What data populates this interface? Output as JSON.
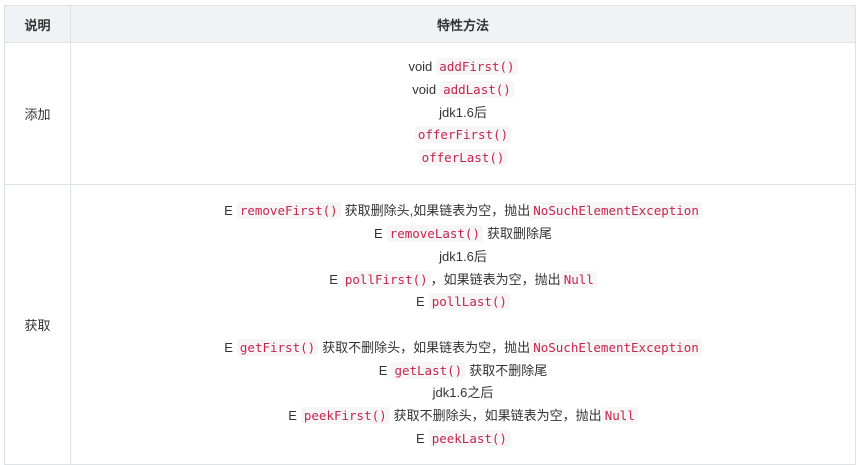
{
  "table": {
    "header": {
      "col1": "说明",
      "col2": "特性方法"
    },
    "rows": [
      {
        "label": "添加",
        "lines": [
          {
            "prefix": "void",
            "code": "addFirst()",
            "suffix": ""
          },
          {
            "prefix": "void",
            "code": "addLast()",
            "suffix": ""
          },
          {
            "prefix": "",
            "text": "jdk1.6后"
          },
          {
            "prefix": "",
            "code": "offerFirst()",
            "suffix": ""
          },
          {
            "prefix": "",
            "code": "offerLast()",
            "suffix": ""
          }
        ]
      },
      {
        "label": "获取",
        "lines": [
          {
            "prefix": "E",
            "code": "removeFirst()",
            "suffix": "获取删除头,如果链表为空，抛出",
            "code2": "NoSuchElementException"
          },
          {
            "prefix": "E",
            "code": "removeLast()",
            "suffix": "获取删除尾"
          },
          {
            "prefix": "",
            "text": "jdk1.6后"
          },
          {
            "prefix": "E",
            "code": "pollFirst()",
            "suffix": "，如果链表为空，抛出",
            "code2": "Null"
          },
          {
            "prefix": "E",
            "code": "pollLast()",
            "suffix": ""
          },
          {
            "blank": true
          },
          {
            "prefix": "E",
            "code": "getFirst()",
            "suffix": "获取不删除头，如果链表为空，抛出",
            "code2": "NoSuchElementException"
          },
          {
            "prefix": "E",
            "code": "getLast()",
            "suffix": "获取不删除尾"
          },
          {
            "prefix": "",
            "text": "jdk1.6之后"
          },
          {
            "prefix": "E",
            "code": "peekFirst()",
            "suffix": "获取不删除头，如果链表为空，抛出",
            "code2": "Null"
          },
          {
            "prefix": "E",
            "code": "peekLast()",
            "suffix": ""
          }
        ]
      }
    ]
  }
}
